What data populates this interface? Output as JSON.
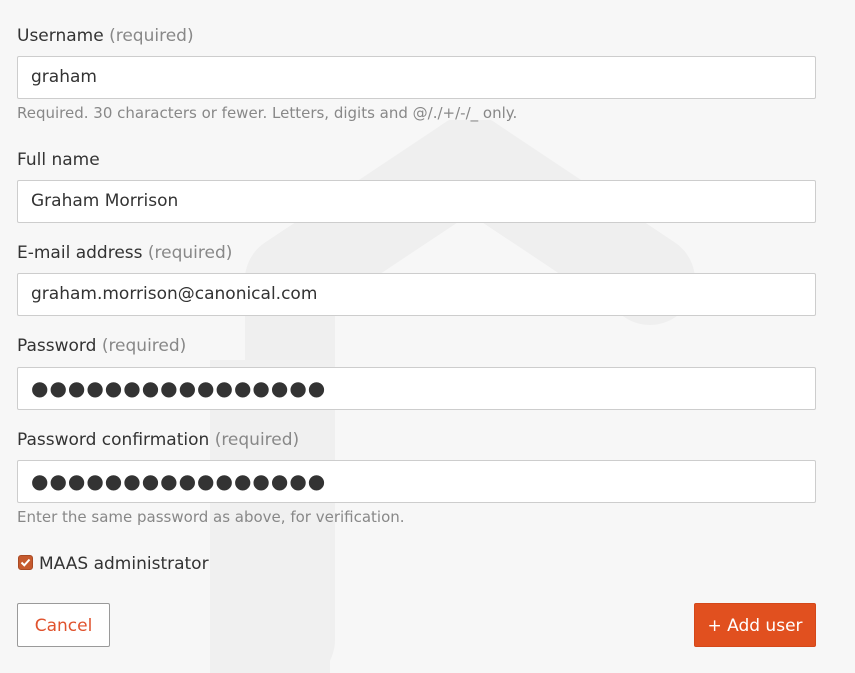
{
  "form": {
    "username": {
      "label": "Username",
      "required": "(required)",
      "value": "graham",
      "help": "Required. 30 characters or fewer. Letters, digits and @/./+/-/_ only."
    },
    "full_name": {
      "label": "Full name",
      "value": "Graham Morrison"
    },
    "email": {
      "label": "E-mail address",
      "required": "(required)",
      "value": "graham.morrison@canonical.com"
    },
    "password": {
      "label": "Password",
      "required": "(required)",
      "masked_value": "●●●●●●●●●●●●●●●●"
    },
    "password_confirmation": {
      "label": "Password confirmation",
      "required": "(required)",
      "masked_value": "●●●●●●●●●●●●●●●●",
      "help": "Enter the same password as above, for verification."
    },
    "admin_checkbox": {
      "label": "MAAS administrator",
      "checked": true
    },
    "buttons": {
      "cancel": "Cancel",
      "add_user": "+ Add user"
    }
  },
  "colors": {
    "accent": "#e1501f",
    "checkbox": "#c65a2e",
    "background": "#f7f7f7"
  }
}
